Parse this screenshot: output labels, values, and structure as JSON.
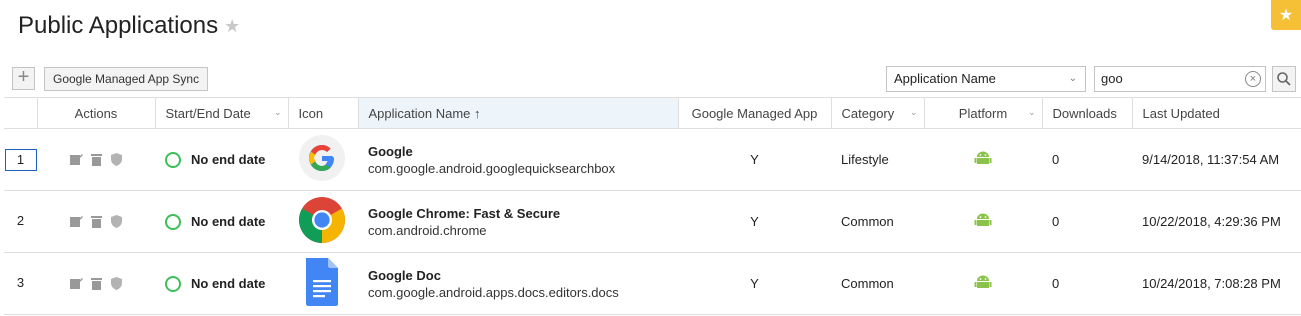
{
  "page": {
    "title": "Public Applications"
  },
  "toolbar": {
    "sync_label": "Google Managed App Sync",
    "filter_selected": "Application Name",
    "search_value": "goo"
  },
  "columns": [
    "Actions",
    "Start/End Date",
    "Icon",
    "Application Name",
    "Google Managed App",
    "Category",
    "Platform",
    "Downloads",
    "Last Updated"
  ],
  "sort_indicator": "↑",
  "rows": [
    {
      "index": "1",
      "status": "No end date",
      "icon": "google-app-icon",
      "name": "Google",
      "package": "com.google.android.googlequicksearchbox",
      "managed": "Y",
      "category": "Lifestyle",
      "platform": "android-icon",
      "downloads": "0",
      "updated": "9/14/2018, 11:37:54 AM"
    },
    {
      "index": "2",
      "status": "No end date",
      "icon": "chrome-app-icon",
      "name": "Google Chrome: Fast & Secure",
      "package": "com.android.chrome",
      "managed": "Y",
      "category": "Common",
      "platform": "android-icon",
      "downloads": "0",
      "updated": "10/22/2018, 4:29:36 PM"
    },
    {
      "index": "3",
      "status": "No end date",
      "icon": "docs-app-icon",
      "name": "Google Doc",
      "package": "com.google.android.apps.docs.editors.docs",
      "managed": "Y",
      "category": "Common",
      "platform": "android-icon",
      "downloads": "0",
      "updated": "10/24/2018, 7:08:28 PM"
    }
  ],
  "colors": {
    "accent_star": "#f5c036",
    "status_green": "#3cbf57",
    "android_green": "#8bc34a"
  }
}
